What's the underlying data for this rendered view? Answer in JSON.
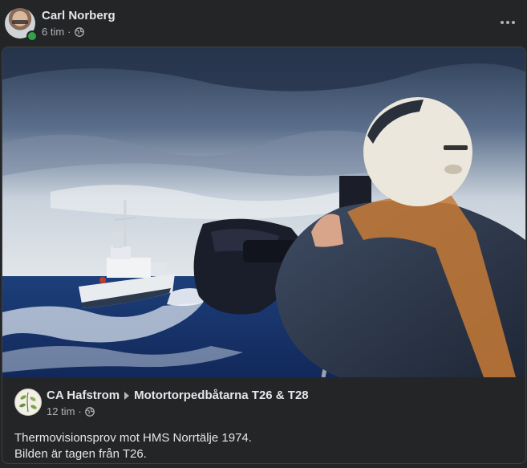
{
  "post": {
    "author": "Carl Norberg",
    "time": "6 tim",
    "separator": "·",
    "privacy_icon": "globe-icon",
    "menu_icon": "more-options-icon"
  },
  "shared": {
    "author": "CA Hafstrom",
    "group": "Motortorpedbåtarna T26 & T28",
    "time": "12 tim",
    "separator": "·",
    "privacy_icon": "globe-icon",
    "text_line1": "Thermovisionsprov mot HMS Norrtälje 1974.",
    "text_line2": "Bilden är tagen från T26."
  },
  "colors": {
    "background": "#242526",
    "text_primary": "#e4e6eb",
    "text_secondary": "#b0b3b8",
    "online": "#31a24c"
  }
}
